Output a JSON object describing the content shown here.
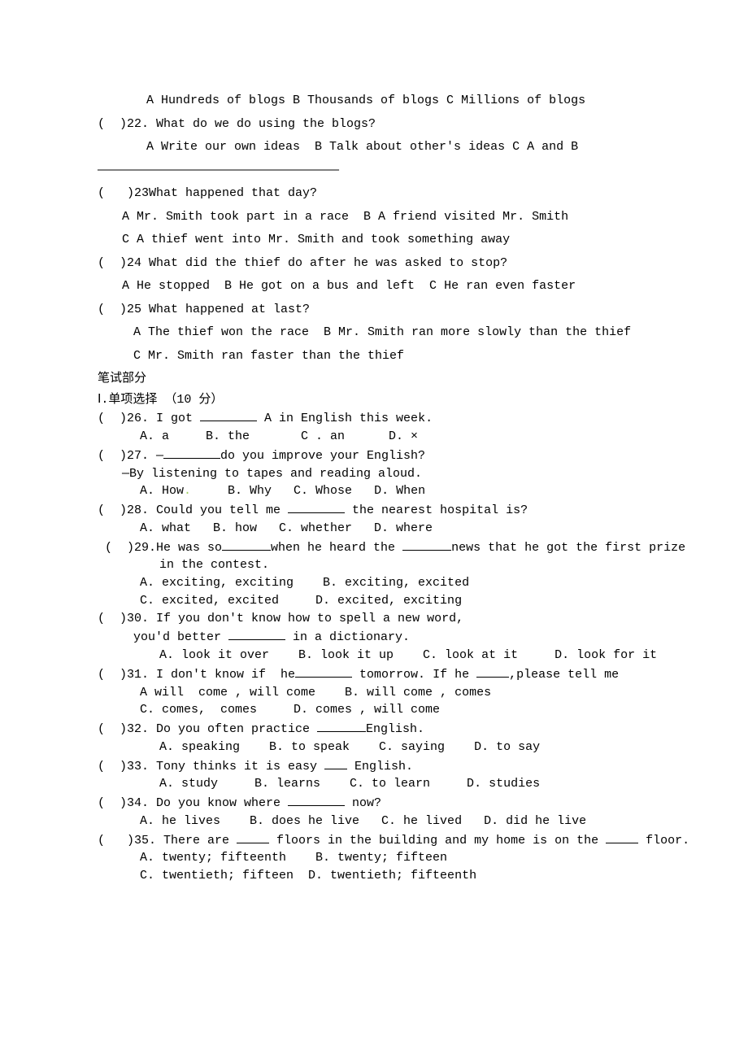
{
  "q21_options": "A Hundreds of blogs B Thousands of blogs C Millions of blogs",
  "q22": "(  )22. What do we do using the blogs?",
  "q22_options": "A Write our own ideas  B Talk about other's ideas C A and B",
  "dashes": "—————————————————————————————————",
  "q23": "(   )23What happened that day?",
  "q23_a": "A Mr. Smith took part in a race  B A friend visited Mr. Smith",
  "q23_c": "C A thief went into Mr. Smith and took something away",
  "q24": "(  )24 What did the thief do after he was asked to stop?",
  "q24_a": "A He stopped  B He got on a bus and left  C He ran even faster",
  "q25": "(  )25 What happened at last?",
  "q25_a": "A The thief won the race  B Mr. Smith ran more slowly than the thief",
  "q25_c": "C Mr. Smith ran faster than the thief",
  "section_title": "笔试部分",
  "part1_title": "Ⅰ.单项选择 （10 分）",
  "q26_p1": "(  )26. I got ",
  "q26_p2": " A in English this week.",
  "q26_opts": "A. a     B. the       C . an      D. ×",
  "q27_p1": "(  )27. —",
  "q27_p2": "do you improve your English?",
  "q27_sub": "—By listening to tapes and reading aloud.",
  "q27_opts_a": "A. How",
  "q27_opts_b": "     B. Why   C. Whose   D. When",
  "q28_p1": "(  )28. Could you tell me ",
  "q28_p2": " the nearest hospital is?",
  "q28_opts": "A. what   B. how   C. whether   D. where",
  "q29_p1": " (  )29.He was so",
  "q29_p2": "when he heard the ",
  "q29_p3": "news that he got the first prize",
  "q29_sub": "in the contest.",
  "q29_optsA": "A. exciting, exciting    B. exciting, excited",
  "q29_optsC": "C. excited, excited     D. excited, exciting",
  "q30": "(  )30. If you don't know how to spell a new word,",
  "q30_sub_p1": "you'd better ",
  "q30_sub_p2": " in a dictionary.",
  "q30_opts": "A. look it over    B. look it up    C. look at it     D. look for it",
  "q31_p1": "(  )31. I don't know if  he",
  "q31_p2": " tomorrow. If he ",
  "q31_p3": ",please tell me",
  "q31_optsA": "A will  come , will come    B. will come , comes",
  "q31_optsC": "C. comes,  comes     D. comes , will come",
  "q32_p1": "(  )32. Do you often practice ",
  "q32_p2": "English.",
  "q32_opts": "A. speaking    B. to speak    C. saying    D. to say",
  "q33_p1": "(  )33. Tony thinks it is easy ",
  "q33_p2": " English.",
  "q33_opts": "A. study     B. learns    C. to learn     D. studies",
  "q34_p1": "(  )34. Do you know where ",
  "q34_p2": " now?",
  "q34_opts": "A. he lives    B. does he live   C. he lived   D. did he live",
  "q35_p1": "(   )35. There are ",
  "q35_p2": " floors in the building and my home is on the ",
  "q35_p3": " floor.",
  "q35_optsA": "A. twenty; fifteenth    B. twenty; fifteen",
  "q35_optsC": "C. twentieth; fifteen  D. twentieth; fifteenth"
}
